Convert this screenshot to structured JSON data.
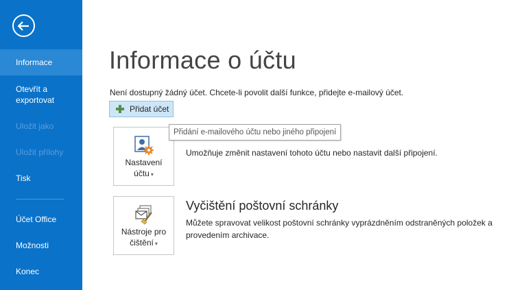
{
  "sidebar": {
    "back_icon": "back-arrow-icon",
    "items": [
      {
        "label": "Informace"
      },
      {
        "label": "Otevřít a exportovat"
      },
      {
        "label": "Uložit jako"
      },
      {
        "label": "Uložit přílohy"
      },
      {
        "label": "Tisk"
      },
      {
        "label": "Účet Office"
      },
      {
        "label": "Možnosti"
      },
      {
        "label": "Konec"
      }
    ]
  },
  "main": {
    "title": "Informace o účtu",
    "notice": "Není dostupný žádný účet. Chcete-li povolit další funkce, přidejte e-mailový účet.",
    "add_account_label": "Přidat účet",
    "tooltip": "Přidání e-mailového účtu nebo jiného připojení",
    "account_settings": {
      "label_line1": "Nastavení",
      "label_line2": "účtu",
      "description": "Umožňuje změnit nastavení tohoto účtu nebo nastavit další připojení."
    },
    "mailbox_cleanup": {
      "heading": "Vyčištění poštovní schránky",
      "label_line1": "Nástroje pro",
      "label_line2": "čištění",
      "description_line1": "Můžete spravovat velikost poštovní schránky vyprázdněním odstraněných položek a",
      "description_line2": "provedením archivace."
    }
  },
  "colors": {
    "sidebar_bg": "#0a72c9",
    "sidebar_selected": "#2a88d4",
    "add_button_bg": "#cde6f7"
  }
}
